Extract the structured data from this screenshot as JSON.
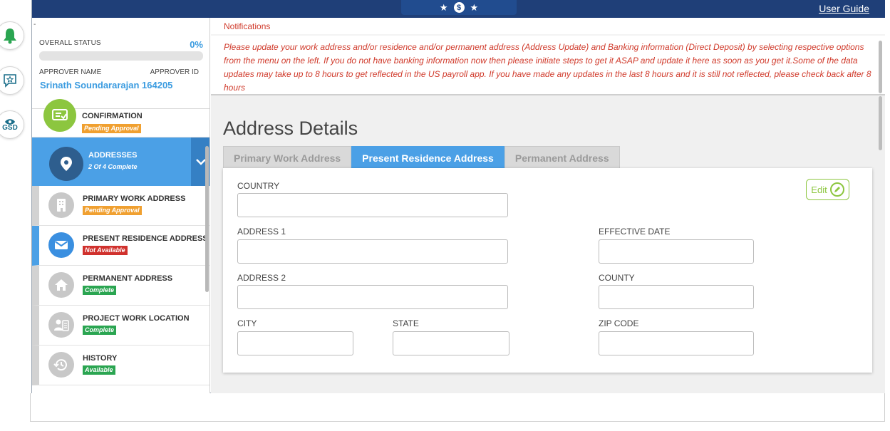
{
  "header": {
    "user_guide": "User Guide",
    "logo_dollar": "$",
    "logo_star": "★"
  },
  "rail": {
    "gsd_label": "GSD"
  },
  "sidebar": {
    "dash": "-",
    "overall_status_label": "OVERALL STATUS",
    "overall_status_value": "0%",
    "progress_fraction": 0,
    "approver_name_label": "APPROVER NAME",
    "approver_id_label": "APPROVER ID",
    "approver_value": "Srinath  Soundararajan 164205",
    "items": [
      {
        "title": "CONFIRMATION",
        "badge": "Pending Approval"
      },
      {
        "title": "ADDRESSES",
        "subline": "2 Of 4 Complete"
      },
      {
        "title": "PRIMARY WORK ADDRESS",
        "badge": "Pending Approval"
      },
      {
        "title": "PRESENT RESIDENCE ADDRESS",
        "badge": "Not Available"
      },
      {
        "title": "PERMANENT ADDRESS",
        "badge": "Complete"
      },
      {
        "title": "PROJECT WORK LOCATION",
        "badge": "Complete"
      },
      {
        "title": "HISTORY",
        "badge": "Available"
      }
    ]
  },
  "notifications": {
    "title": "Notifications",
    "text": "Please update your work address and/or residence and/or permanent address (Address Update) and Banking information (Direct Deposit) by selecting respective options from the menu on the left. If you do not have banking information now then please initiate steps to get it ASAP and update it here as soon as you get it.Some of the data updates may take up to 8 hours to get reflected in the US payroll app. If you have made any updates in the last 8 hours and it is still not reflected, please check back after 8 hours"
  },
  "main": {
    "title": "Address Details",
    "tabs": [
      "Primary Work Address",
      "Present Residence Address",
      "Permanent Address"
    ],
    "active_tab": 1,
    "edit_label": "Edit",
    "fields": {
      "country": {
        "label": "COUNTRY",
        "value": ""
      },
      "address1": {
        "label": "ADDRESS 1",
        "value": ""
      },
      "address2": {
        "label": "ADDRESS 2",
        "value": ""
      },
      "city": {
        "label": "CITY",
        "value": ""
      },
      "state": {
        "label": "STATE",
        "value": ""
      },
      "effective_date": {
        "label": "EFFECTIVE DATE",
        "value": ""
      },
      "county": {
        "label": "COUNTY",
        "value": ""
      },
      "zip": {
        "label": "ZIP CODE",
        "value": ""
      }
    }
  },
  "colors": {
    "topbar": "#1f3f78",
    "accent_blue": "#4ba0e6",
    "notice_red": "#d03a2b",
    "confirm_green": "#8cc63f",
    "pending_orange": "#f0a030",
    "complete_green": "#2aa551",
    "not_available_red": "#d0312d"
  }
}
